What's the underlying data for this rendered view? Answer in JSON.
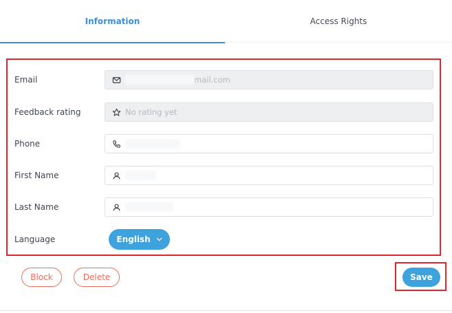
{
  "tabs": [
    {
      "label": "Information",
      "active": true
    },
    {
      "label": "Access Rights",
      "active": false
    }
  ],
  "form": {
    "email": {
      "label": "Email",
      "value": "mail.com",
      "icon": "mail-icon"
    },
    "feedback": {
      "label": "Feedback rating",
      "value": "No rating yet",
      "icon": "star-icon"
    },
    "phone": {
      "label": "Phone",
      "value": "",
      "icon": "phone-icon"
    },
    "first_name": {
      "label": "First Name",
      "value": "",
      "icon": "user-icon"
    },
    "last_name": {
      "label": "Last Name",
      "value": "",
      "icon": "user-icon"
    },
    "language": {
      "label": "Language",
      "value": "English",
      "icon": "chevron-down-icon"
    }
  },
  "actions": {
    "block_label": "Block",
    "delete_label": "Delete",
    "save_label": "Save"
  },
  "colors": {
    "accent": "#3ea2dc",
    "tab_active": "#3d8fd6",
    "danger": "#ef6b57",
    "highlight": "#e0242c"
  }
}
